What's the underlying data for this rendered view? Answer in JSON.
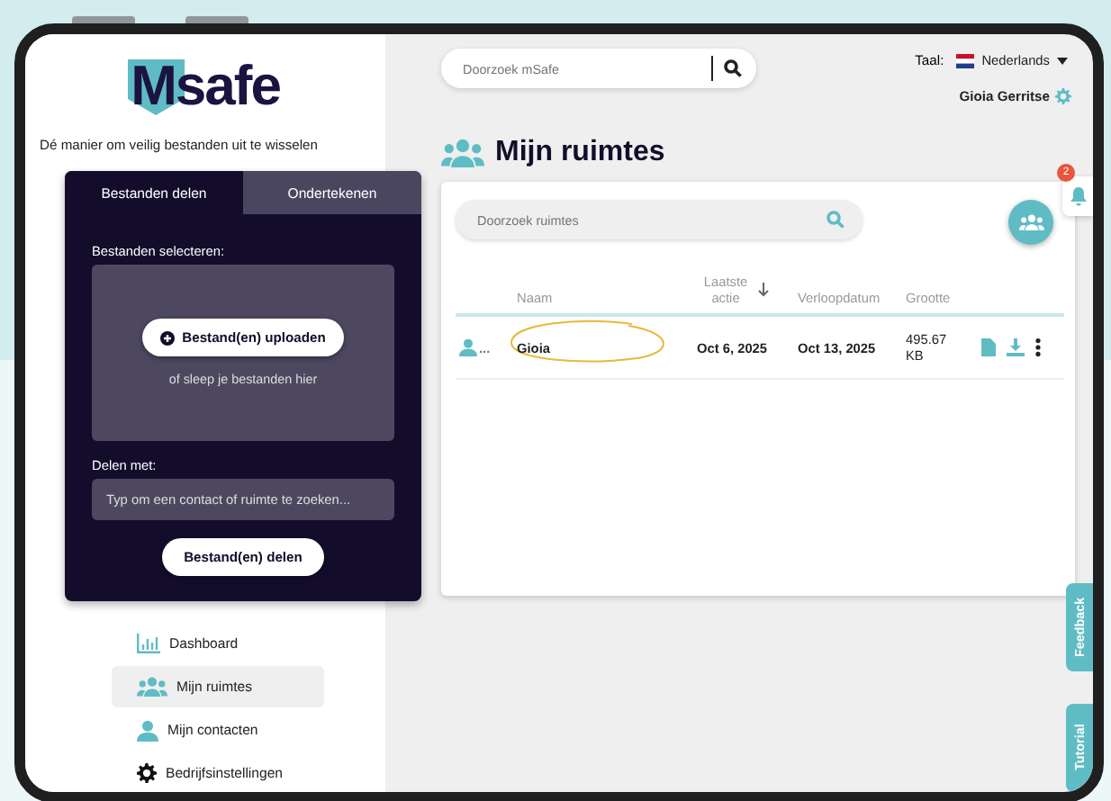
{
  "sidebar": {
    "logo": "Msafe",
    "tagline": "Dé manier om veilig bestanden uit te wisselen",
    "share_card": {
      "tabs": [
        {
          "label": "Bestanden delen",
          "selected": true
        },
        {
          "label": "Ondertekenen",
          "selected": false
        }
      ],
      "select_label": "Bestanden selecteren:",
      "upload_button": "Bestand(en) uploaden",
      "drop_hint": "of sleep je bestanden hier",
      "share_with_label": "Delen met:",
      "share_with_placeholder": "Typ om een contact of ruimte te zoeken...",
      "share_button": "Bestand(en) delen"
    },
    "nav": [
      {
        "label": "Dashboard",
        "kind": "chart",
        "selected": false
      },
      {
        "label": "Mijn ruimtes",
        "kind": "people",
        "selected": true
      },
      {
        "label": "Mijn contacten",
        "kind": "person",
        "selected": false
      },
      {
        "label": "Bedrijfsinstellingen",
        "kind": "gear",
        "selected": false
      }
    ]
  },
  "header": {
    "search_placeholder": "Doorzoek mSafe",
    "language_label": "Taal:",
    "language": "Nederlands",
    "user": "Gioia Gerritse"
  },
  "page_title": "Mijn ruimtes",
  "notifications": {
    "count": "2"
  },
  "rooms": {
    "search_placeholder": "Doorzoek ruimtes",
    "columns": [
      "Naam",
      "Laatste actie",
      "Verloopdatum",
      "Grootte"
    ],
    "rows": [
      {
        "type_suffix": "...",
        "name": "Gioia",
        "last_action": "Oct 6, 2025",
        "expires": "Oct 13, 2025",
        "size": "495.67 KB",
        "highlighted": true
      }
    ]
  },
  "side_tabs": [
    "Feedback",
    "Tutorial"
  ]
}
